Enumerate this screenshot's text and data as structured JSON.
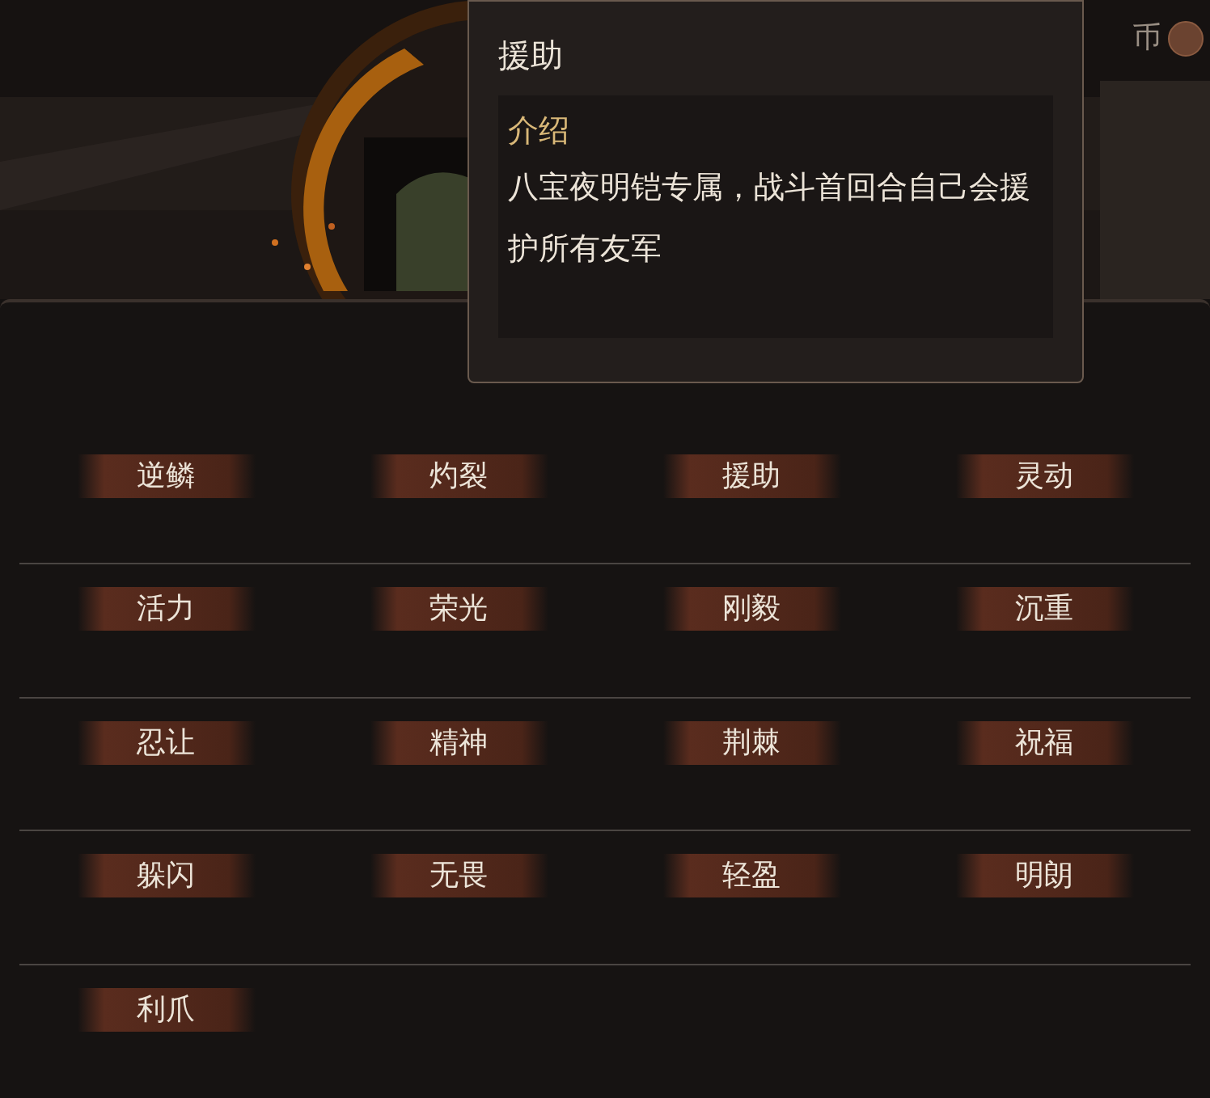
{
  "currency": {
    "label": "币"
  },
  "tooltip": {
    "title": "援助",
    "section_heading": "介绍",
    "description": "八宝夜明铠专属，战斗首回合自己会援护所有友军"
  },
  "skills": [
    {
      "label": "逆鳞"
    },
    {
      "label": "灼裂"
    },
    {
      "label": "援助"
    },
    {
      "label": "灵动"
    },
    {
      "label": "活力"
    },
    {
      "label": "荣光"
    },
    {
      "label": "刚毅"
    },
    {
      "label": "沉重"
    },
    {
      "label": "忍让"
    },
    {
      "label": "精神"
    },
    {
      "label": "荆棘"
    },
    {
      "label": "祝福"
    },
    {
      "label": "躲闪"
    },
    {
      "label": "无畏"
    },
    {
      "label": "轻盈"
    },
    {
      "label": "明朗"
    },
    {
      "label": "利爪"
    }
  ]
}
